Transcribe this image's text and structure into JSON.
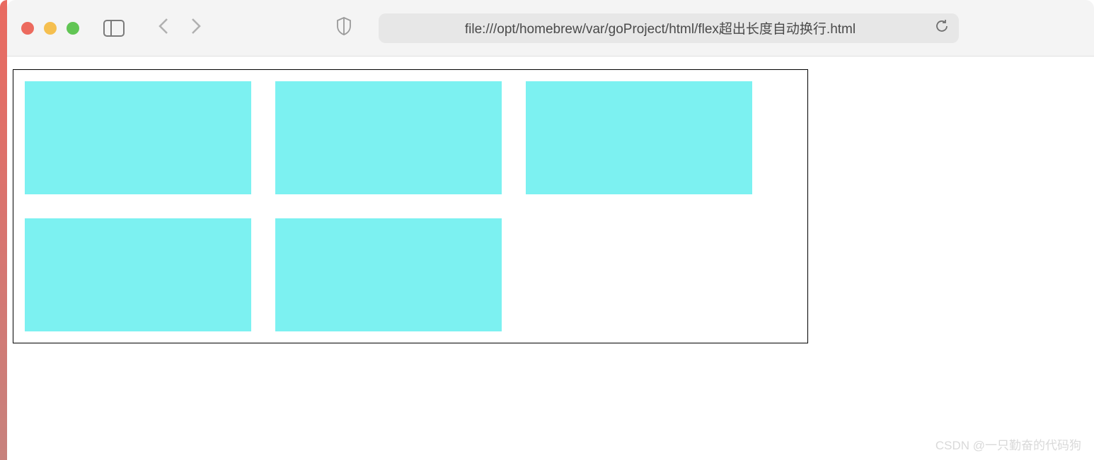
{
  "browser": {
    "address": "file:///opt/homebrew/var/goProject/html/flex超出长度自动换行.html"
  },
  "content": {
    "container": {
      "item_count": 5,
      "item_color": "#7cf1f1"
    }
  },
  "watermark": "CSDN @一只勤奋的代码狗"
}
